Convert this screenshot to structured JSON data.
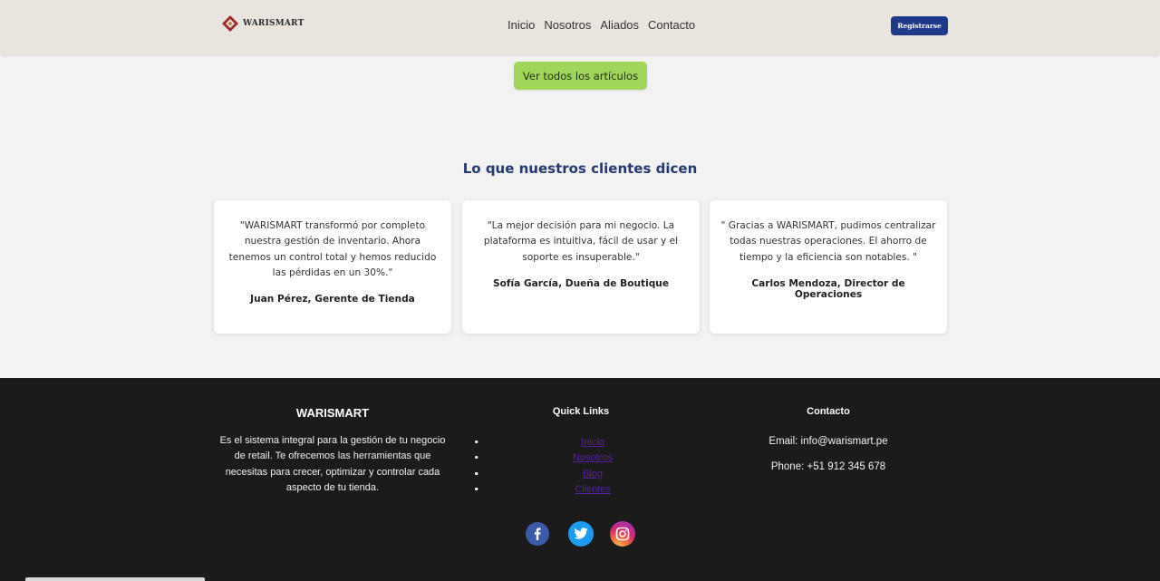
{
  "brand": {
    "name": "WARISMART",
    "colors": {
      "primary": "#1f3a8a",
      "accent": "#9fd65a",
      "logo": "#a02b2b"
    }
  },
  "nav": {
    "items": [
      "Inicio",
      "Nosotros",
      "Aliados",
      "Contacto"
    ],
    "register_label": "Registrarse"
  },
  "articles": {
    "view_all_label": "Ver todos los artículos"
  },
  "testimonials": {
    "title": "Lo que nuestros clientes dicen",
    "items": [
      {
        "quote": "\"WARISMART transformó por completo nuestra gestión de inventario. Ahora tenemos un control total y hemos reducido las pérdidas en un 30%.\"",
        "author": "Juan Pérez, Gerente de Tienda"
      },
      {
        "quote": "\"La mejor decisión para mi negocio. La plataforma es intuitiva, fácil de usar y el soporte es insuperable.\"",
        "author": "Sofía García, Dueña de Boutique"
      },
      {
        "quote": "\" Gracias a WARISMART, pudimos centralizar todas nuestras operaciones. El ahorro de tiempo y la eficiencia son notables. \"",
        "author": "Carlos Mendoza, Director de Operaciones"
      }
    ]
  },
  "footer": {
    "brand_title": "WARISMART",
    "description": "Es el sistema integral para la gestión de tu negocio de retail. Te ofrecemos las herramientas que necesitas para crecer, optimizar y controlar cada aspecto de tu tienda.",
    "quick_links_title": "Quick Links",
    "quick_links": [
      "Inicio",
      "Nosotros",
      "Blog",
      "Clientes"
    ],
    "contact_title": "Contacto",
    "email": "Email: info@warismart.pe",
    "phone": "Phone: +51 912 345 678",
    "social": [
      "facebook-icon",
      "twitter-icon",
      "instagram-icon"
    ]
  }
}
